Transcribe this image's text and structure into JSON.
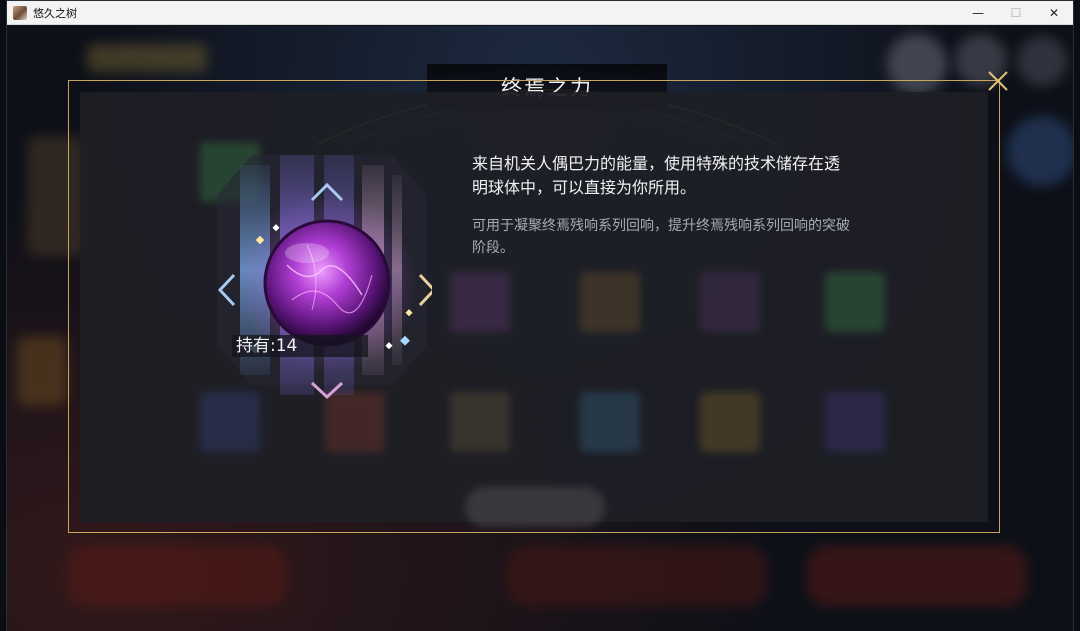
{
  "window": {
    "title": "悠久之树",
    "minimize_glyph": "—",
    "maximize_glyph": "☐",
    "close_glyph": "✕"
  },
  "item": {
    "name": "终焉之力",
    "owned_label": "持有:14",
    "description": "来自机关人偶巴力的能量，使用特殊的技术储存在透明球体中，可以直接为你所用。",
    "usage": "可用于凝聚终焉残响系列回响，提升终焉残响系列回响的突破阶段。",
    "icon": "purple-energy-orb-icon"
  },
  "colors": {
    "frame_gold": "#c9a45c",
    "orb_purple": "#b23fd6",
    "panel": "#1e1f26"
  }
}
